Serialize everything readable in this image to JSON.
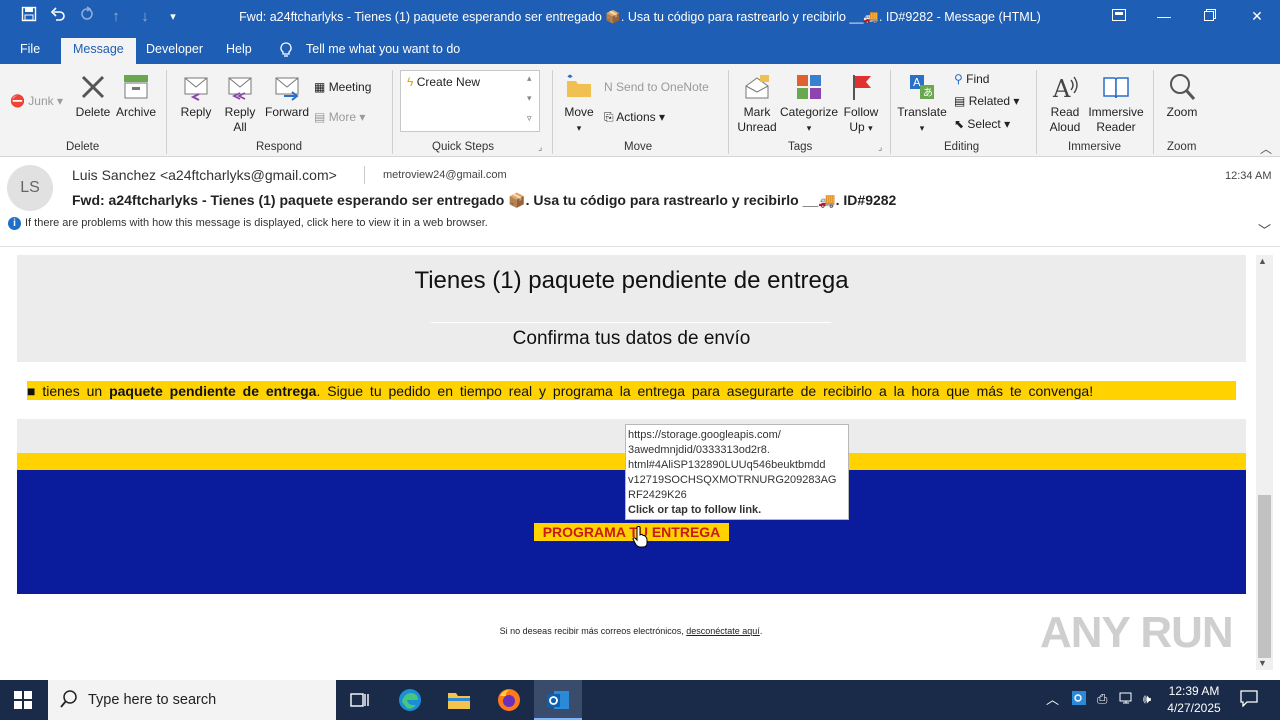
{
  "window": {
    "title": "Fwd: a24ftcharlyks - Tienes (1) paquete esperando ser entregado 📦. Usa tu código para rastrearlo y recibirlo __🚚. ID#9282  -  Message (HTML)"
  },
  "menu": {
    "file": "File",
    "message": "Message",
    "developer": "Developer",
    "help": "Help",
    "tell_me": "Tell me what you want to do"
  },
  "ribbon": {
    "junk": "Junk",
    "delete": "Delete",
    "archive": "Archive",
    "group_delete": "Delete",
    "reply": "Reply",
    "reply_all_1": "Reply",
    "reply_all_2": "All",
    "forward": "Forward",
    "meeting": "Meeting",
    "more": "More",
    "group_respond": "Respond",
    "create_new": "Create New",
    "group_quick_steps": "Quick Steps",
    "move": "Move",
    "send_onenote": "Send to OneNote",
    "actions": "Actions",
    "group_move": "Move",
    "mark_unread_1": "Mark",
    "mark_unread_2": "Unread",
    "categorize": "Categorize",
    "follow_up_1": "Follow",
    "follow_up_2": "Up",
    "group_tags": "Tags",
    "translate": "Translate",
    "find": "Find",
    "related": "Related",
    "select": "Select",
    "group_editing": "Editing",
    "read_aloud_1": "Read",
    "read_aloud_2": "Aloud",
    "immersive_1": "Immersive",
    "immersive_2": "Reader",
    "group_immersive": "Immersive",
    "zoom": "Zoom",
    "group_zoom": "Zoom"
  },
  "header": {
    "avatar_initials": "LS",
    "from": "Luis Sanchez <a24ftcharlyks@gmail.com>",
    "to": "metroview24@gmail.com",
    "time": "12:34 AM",
    "subject": "Fwd: a24ftcharlyks - Tienes (1) paquete esperando ser entregado 📦. Usa tu código para rastrearlo y recibirlo __🚚. ID#9282",
    "info_bar": "If there are problems with how this message is displayed, click here to view it in a web browser."
  },
  "email": {
    "heading": "Tienes (1) paquete pendiente de entrega",
    "subheading": "Confirma tus datos de envío",
    "notice_bullet": "■",
    "notice_pre": "tienes un",
    "notice_bold": "paquete pendiente de entrega",
    "notice_post": ". Sigue tu pedido en tiempo real y programa la entrega para asegurarte de recibirlo a la hora que más te convenga!",
    "cta": "PROGRAMA TU ENTREGA",
    "footer_text": "Si no deseas recibir más correos electrónicos,",
    "footer_link": "desconéctate aquí",
    "footer_end": "."
  },
  "tooltip": {
    "url_1": "https://storage.googleapis.com/",
    "url_2": "3awedmnjdid/0333313od2r8.",
    "url_3": "html#4AliSP132890LUUq546beuktbmdd",
    "url_4": "v12719SOCHSQXMOTRNURG209283AG",
    "url_5": "RF2429K26",
    "hint": "Click or tap to follow link."
  },
  "watermark": "ANY RUN",
  "taskbar": {
    "search_placeholder": "Type here to search",
    "time": "12:39 AM",
    "date": "4/27/2025"
  }
}
